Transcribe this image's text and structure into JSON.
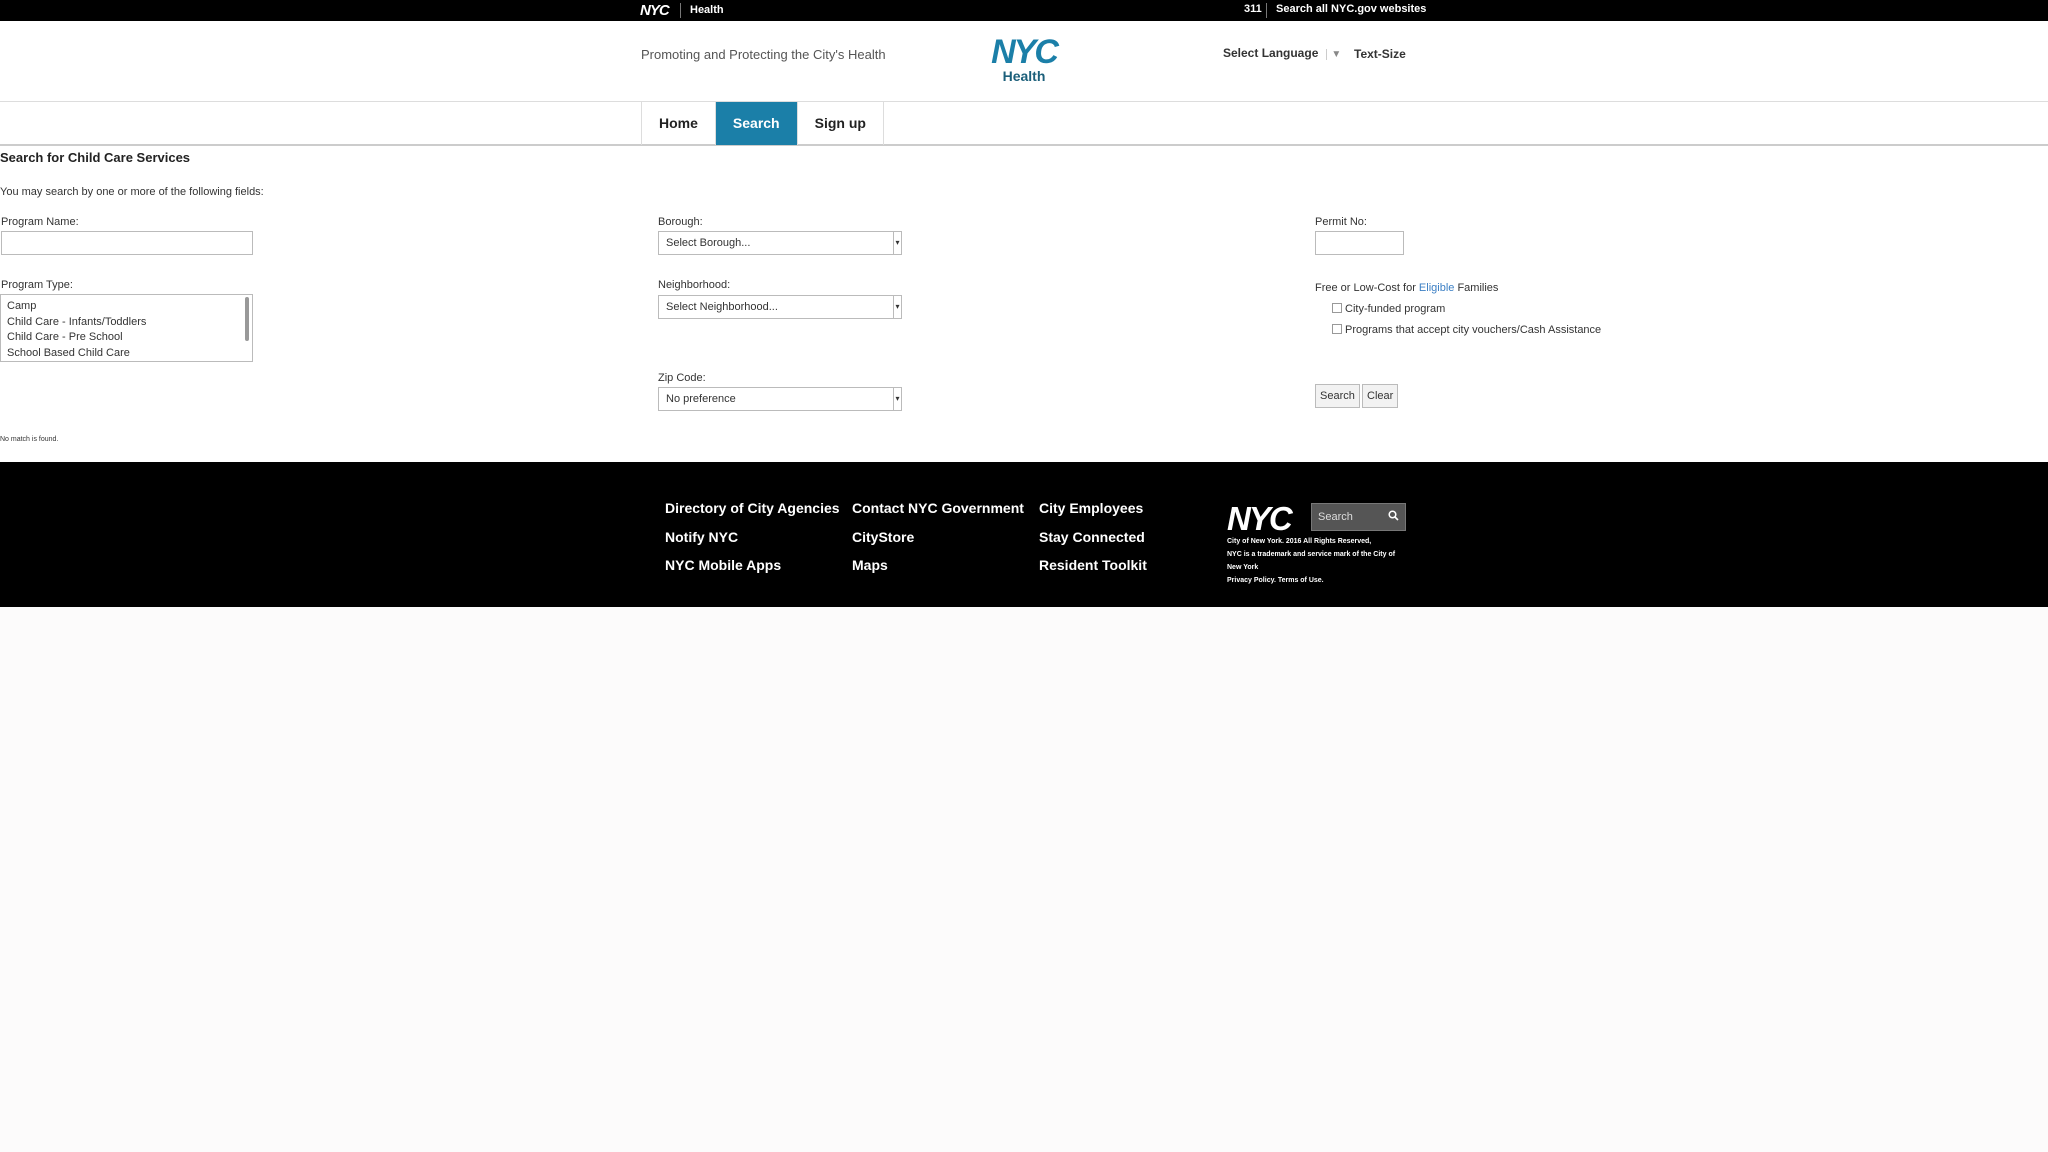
{
  "topbar": {
    "nyc": "NYC",
    "health": "Health",
    "t311": "311",
    "search_all": "Search all NYC.gov websites"
  },
  "header": {
    "tagline": "Promoting and Protecting the City's Health",
    "logo_nyc": "NYC",
    "logo_health": "Health",
    "select_language": "Select Language",
    "language_arrow": "▼",
    "text_size": "Text-Size"
  },
  "nav": {
    "tabs": [
      {
        "label": "Home"
      },
      {
        "label": "Search"
      },
      {
        "label": "Sign up"
      }
    ],
    "active": "Search"
  },
  "form": {
    "title": "Search for Child Care Services",
    "intro": "You may search by one or more of the following fields:",
    "program_name_label": "Program Name:",
    "program_name_value": "",
    "program_type_label": "Program Type:",
    "program_types": [
      "Camp",
      "Child Care - Infants/Toddlers",
      "Child Care - Pre School",
      "School Based Child Care"
    ],
    "borough_label": "Borough:",
    "borough_value": "Select Borough...",
    "neighborhood_label": "Neighborhood:",
    "neighborhood_value": "Select Neighborhood...",
    "zip_label": "Zip Code:",
    "zip_value": "No preference",
    "permit_label": "Permit No:",
    "permit_value": "",
    "free_prefix": "Free or Low-Cost for ",
    "free_link": "Eligible",
    "free_suffix": " Families",
    "checkbox_city_funded": "City-funded program",
    "checkbox_vouchers": "Programs that accept city vouchers/Cash Assistance",
    "search_button": "Search",
    "clear_button": "Clear",
    "no_match": "No match is found."
  },
  "footer": {
    "links": [
      "Directory of City Agencies",
      "Contact NYC Government",
      "City Employees",
      "Notify NYC",
      "CityStore",
      "Stay Connected",
      "NYC Mobile Apps",
      "Maps",
      "Resident Toolkit"
    ],
    "logo": "NYC",
    "search_placeholder": "Search",
    "copyright": "City of New York. 2016 All Rights Reserved,",
    "trademark_1": "NYC is a trademark and service mark of the City of",
    "trademark_2": "New York",
    "policy": "Privacy Policy. Terms of Use."
  },
  "colors": {
    "accent": "#1b7fa8",
    "link": "#3b7fc4"
  }
}
